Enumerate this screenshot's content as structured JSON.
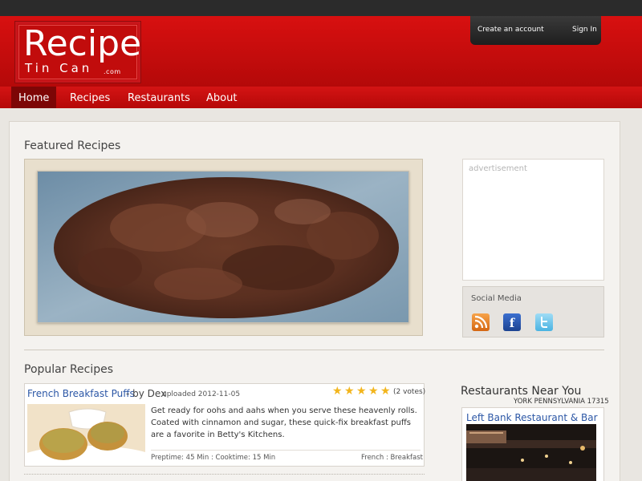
{
  "logo": {
    "main": "Recipe",
    "sub": "Tin Can",
    "suffix": ".com"
  },
  "account": {
    "create_label": "Create an account",
    "signin_label": "Sign In"
  },
  "nav": {
    "items": [
      {
        "label": "Home",
        "active": true
      },
      {
        "label": "Recipes",
        "active": false
      },
      {
        "label": "Restaurants",
        "active": false
      },
      {
        "label": "About",
        "active": false
      }
    ]
  },
  "featured": {
    "title": "Featured Recipes"
  },
  "sidebar": {
    "ad_label": "advertisement",
    "social": {
      "title": "Social Media",
      "icons": [
        "rss-icon",
        "facebook-icon",
        "twitter-icon"
      ]
    }
  },
  "popular": {
    "title": "Popular Recipes",
    "recipes": [
      {
        "title": "French Breakfast Puffs",
        "by": "- by Dex",
        "uploaded": "uploaded 2012-11-05",
        "rating": 5,
        "votes": "(2 votes)",
        "description": "Get ready for oohs and aahs when you serve these heavenly rolls. Coated with cinnamon and sugar, these quick-fix breakfast puffs are a favorite in Betty's Kitchens.",
        "times": "Preptime: 45 Min : Cooktime: 15 Min",
        "category": "French : Breakfast"
      }
    ]
  },
  "restaurants": {
    "title": "Restaurants Near You",
    "location": "YORK PENNSYLVANIA 17315",
    "items": [
      {
        "name": "Left Bank Restaurant & Bar"
      }
    ]
  },
  "colors": {
    "header_red": "#c70e0e",
    "nav_active": "#7d0606",
    "link_blue": "#2c57a6",
    "star_gold": "#f2b51d",
    "top_bar": "#2b2b2b"
  }
}
